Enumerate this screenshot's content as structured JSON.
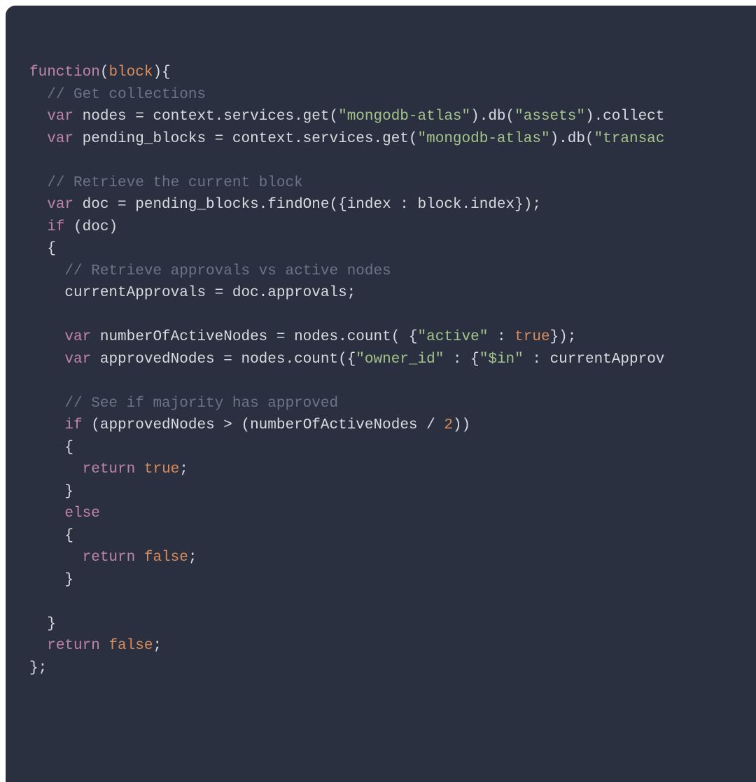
{
  "colors": {
    "background": "#2b3040",
    "default": "#d7dbe0",
    "keyword": "#c084a8",
    "param": "#d98c5b",
    "boolean": "#d98c5b",
    "number": "#d98c5b",
    "string": "#a4c48a",
    "comment": "#6b7486"
  },
  "code": {
    "lines": [
      [
        {
          "t": "keyword",
          "s": "function"
        },
        {
          "t": "punct",
          "s": "("
        },
        {
          "t": "param",
          "s": "block"
        },
        {
          "t": "punct",
          "s": "){"
        }
      ],
      [
        {
          "t": "punct",
          "s": "  "
        },
        {
          "t": "comment",
          "s": "// Get collections"
        }
      ],
      [
        {
          "t": "punct",
          "s": "  "
        },
        {
          "t": "keyword",
          "s": "var"
        },
        {
          "t": "ident",
          "s": " nodes = context.services.get("
        },
        {
          "t": "string",
          "s": "\"mongodb-atlas\""
        },
        {
          "t": "ident",
          "s": ").db("
        },
        {
          "t": "string",
          "s": "\"assets\""
        },
        {
          "t": "ident",
          "s": ").collect"
        }
      ],
      [
        {
          "t": "punct",
          "s": "  "
        },
        {
          "t": "keyword",
          "s": "var"
        },
        {
          "t": "ident",
          "s": " pending_blocks = context.services.get("
        },
        {
          "t": "string",
          "s": "\"mongodb-atlas\""
        },
        {
          "t": "ident",
          "s": ").db("
        },
        {
          "t": "string",
          "s": "\"transac"
        }
      ],
      [
        {
          "t": "punct",
          "s": ""
        }
      ],
      [
        {
          "t": "punct",
          "s": "  "
        },
        {
          "t": "comment",
          "s": "// Retrieve the current block"
        }
      ],
      [
        {
          "t": "punct",
          "s": "  "
        },
        {
          "t": "keyword",
          "s": "var"
        },
        {
          "t": "ident",
          "s": " doc = pending_blocks.findOne({index : block.index});"
        }
      ],
      [
        {
          "t": "punct",
          "s": "  "
        },
        {
          "t": "keyword",
          "s": "if"
        },
        {
          "t": "ident",
          "s": " (doc)"
        }
      ],
      [
        {
          "t": "ident",
          "s": "  {"
        }
      ],
      [
        {
          "t": "punct",
          "s": "    "
        },
        {
          "t": "comment",
          "s": "// Retrieve approvals vs active nodes"
        }
      ],
      [
        {
          "t": "ident",
          "s": "    currentApprovals = doc.approvals;"
        }
      ],
      [
        {
          "t": "punct",
          "s": ""
        }
      ],
      [
        {
          "t": "punct",
          "s": "    "
        },
        {
          "t": "keyword",
          "s": "var"
        },
        {
          "t": "ident",
          "s": " numberOfActiveNodes = nodes.count( {"
        },
        {
          "t": "string",
          "s": "\"active\""
        },
        {
          "t": "ident",
          "s": " : "
        },
        {
          "t": "bool",
          "s": "true"
        },
        {
          "t": "ident",
          "s": "});"
        }
      ],
      [
        {
          "t": "punct",
          "s": "    "
        },
        {
          "t": "keyword",
          "s": "var"
        },
        {
          "t": "ident",
          "s": " approvedNodes = nodes.count({"
        },
        {
          "t": "string",
          "s": "\"owner_id\""
        },
        {
          "t": "ident",
          "s": " : {"
        },
        {
          "t": "string",
          "s": "\"$in\""
        },
        {
          "t": "ident",
          "s": " : currentApprov"
        }
      ],
      [
        {
          "t": "punct",
          "s": ""
        }
      ],
      [
        {
          "t": "punct",
          "s": "    "
        },
        {
          "t": "comment",
          "s": "// See if majority has approved"
        }
      ],
      [
        {
          "t": "punct",
          "s": "    "
        },
        {
          "t": "keyword",
          "s": "if"
        },
        {
          "t": "ident",
          "s": " (approvedNodes > (numberOfActiveNodes / "
        },
        {
          "t": "number",
          "s": "2"
        },
        {
          "t": "ident",
          "s": "))"
        }
      ],
      [
        {
          "t": "ident",
          "s": "    {"
        }
      ],
      [
        {
          "t": "punct",
          "s": "      "
        },
        {
          "t": "keyword",
          "s": "return"
        },
        {
          "t": "ident",
          "s": " "
        },
        {
          "t": "bool",
          "s": "true"
        },
        {
          "t": "ident",
          "s": ";"
        }
      ],
      [
        {
          "t": "ident",
          "s": "    }"
        }
      ],
      [
        {
          "t": "punct",
          "s": "    "
        },
        {
          "t": "keyword",
          "s": "else"
        }
      ],
      [
        {
          "t": "ident",
          "s": "    {"
        }
      ],
      [
        {
          "t": "punct",
          "s": "      "
        },
        {
          "t": "keyword",
          "s": "return"
        },
        {
          "t": "ident",
          "s": " "
        },
        {
          "t": "bool",
          "s": "false"
        },
        {
          "t": "ident",
          "s": ";"
        }
      ],
      [
        {
          "t": "ident",
          "s": "    }"
        }
      ],
      [
        {
          "t": "punct",
          "s": ""
        }
      ],
      [
        {
          "t": "ident",
          "s": "  }"
        }
      ],
      [
        {
          "t": "punct",
          "s": "  "
        },
        {
          "t": "keyword",
          "s": "return"
        },
        {
          "t": "ident",
          "s": " "
        },
        {
          "t": "bool",
          "s": "false"
        },
        {
          "t": "ident",
          "s": ";"
        }
      ],
      [
        {
          "t": "ident",
          "s": "};"
        }
      ]
    ]
  }
}
